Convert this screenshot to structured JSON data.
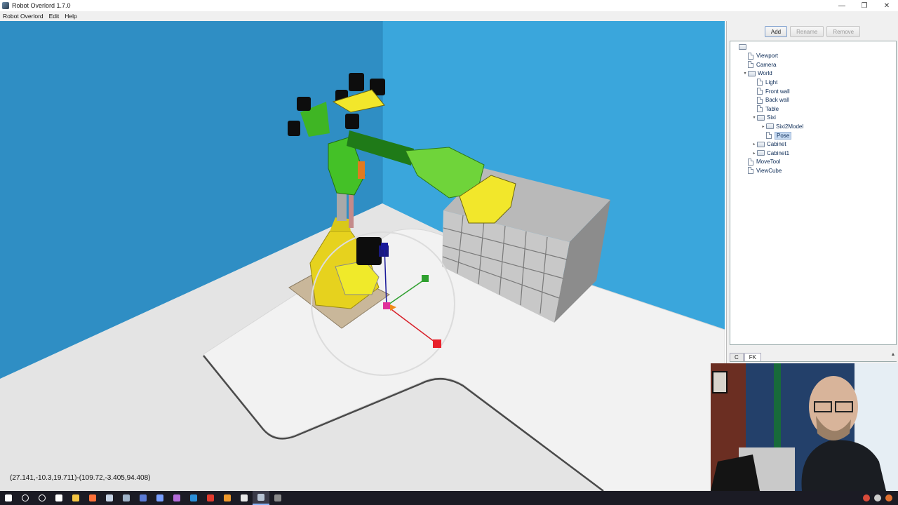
{
  "window": {
    "title": "Robot Overlord 1.7.0",
    "controls": {
      "minimize": "—",
      "restore": "❐",
      "close": "✕"
    }
  },
  "menu": [
    "Robot Overlord",
    "Edit",
    "Help"
  ],
  "viewport": {
    "coordinates": "(27.141,-10.3,19.711)-(109.72,-3.405,94.408)"
  },
  "panel": {
    "buttons": {
      "add": "Add",
      "rename": "Rename",
      "remove": "Remove"
    },
    "tree": [
      {
        "label": "",
        "kind": "folder",
        "level": 0,
        "toggle": ""
      },
      {
        "label": "Viewport",
        "kind": "doc",
        "level": 1,
        "toggle": ""
      },
      {
        "label": "Camera",
        "kind": "doc",
        "level": 1,
        "toggle": ""
      },
      {
        "label": "World",
        "kind": "folder",
        "level": 1,
        "toggle": "▾"
      },
      {
        "label": "Light",
        "kind": "doc",
        "level": 2,
        "toggle": ""
      },
      {
        "label": "Front wall",
        "kind": "doc",
        "level": 2,
        "toggle": ""
      },
      {
        "label": "Back wall",
        "kind": "doc",
        "level": 2,
        "toggle": ""
      },
      {
        "label": "Table",
        "kind": "doc",
        "level": 2,
        "toggle": ""
      },
      {
        "label": "Sixi",
        "kind": "folder",
        "level": 2,
        "toggle": "▾"
      },
      {
        "label": "Sixi2Model",
        "kind": "folder",
        "level": 3,
        "toggle": "▸"
      },
      {
        "label": "Pose",
        "kind": "doc",
        "level": 3,
        "toggle": "",
        "selected": true
      },
      {
        "label": "Cabinet",
        "kind": "folder",
        "level": 2,
        "toggle": "▸"
      },
      {
        "label": "Cabinet1",
        "kind": "folder",
        "level": 2,
        "toggle": "▸"
      },
      {
        "label": "MoveTool",
        "kind": "doc",
        "level": 1,
        "toggle": ""
      },
      {
        "label": "ViewCube",
        "kind": "doc",
        "level": 1,
        "toggle": ""
      }
    ],
    "tabs": [
      "C",
      "FK"
    ]
  },
  "taskbar": {
    "icons": [
      {
        "name": "windows-start-icon",
        "color": "#ffffff"
      },
      {
        "name": "search-icon",
        "color": "#ffffff"
      },
      {
        "name": "cortana-icon",
        "color": "#ffffff"
      },
      {
        "name": "task-view-icon",
        "color": "#ffffff"
      },
      {
        "name": "file-explorer-icon",
        "color": "#f4c542"
      },
      {
        "name": "firefox-icon",
        "color": "#ff7139"
      },
      {
        "name": "app-icon",
        "color": "#c7d4e6"
      },
      {
        "name": "steam-icon",
        "color": "#9fb3c8"
      },
      {
        "name": "app-icon",
        "color": "#5b7bd5"
      },
      {
        "name": "app-icon",
        "color": "#7aa0ff"
      },
      {
        "name": "app-icon",
        "color": "#b46cd9"
      },
      {
        "name": "vscode-icon",
        "color": "#2b8fd8"
      },
      {
        "name": "acrobat-icon",
        "color": "#e23b2e"
      },
      {
        "name": "app-icon",
        "color": "#f09a2c"
      },
      {
        "name": "chrome-icon",
        "color": "#e8e8e8"
      },
      {
        "name": "robot-overlord-icon",
        "color": "#b8c4d4",
        "active": true
      },
      {
        "name": "app-icon",
        "color": "#8a8a8a"
      }
    ],
    "tray": [
      {
        "name": "tray-app-icon",
        "color": "#d94a3a"
      },
      {
        "name": "tray-app-icon",
        "color": "#cccccc"
      },
      {
        "name": "tray-app-icon",
        "color": "#e07030"
      }
    ]
  }
}
